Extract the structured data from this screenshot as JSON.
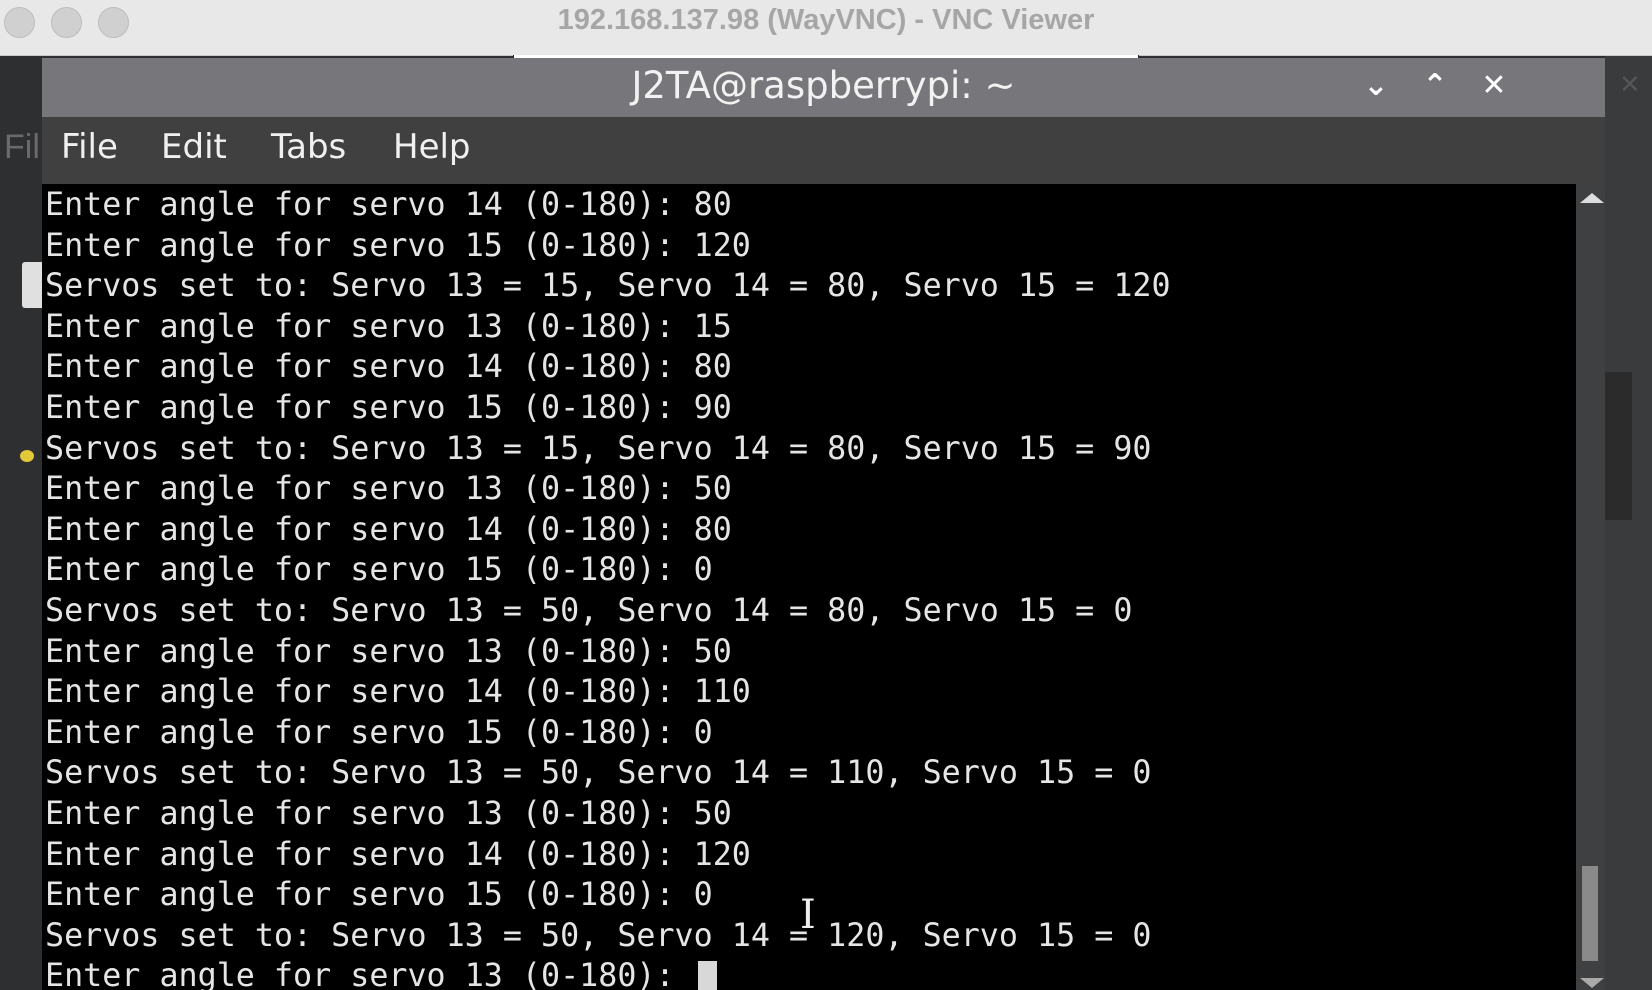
{
  "vnc_window": {
    "title": "192.168.137.98 (WayVNC) - VNC Viewer"
  },
  "background_fragment": "Fil",
  "terminal_window": {
    "title": "J2TA@raspberrypi: ~",
    "controls": {
      "minimize": "⌄",
      "maximize": "⌃",
      "close": "✕"
    },
    "menu": [
      "File",
      "Edit",
      "Tabs",
      "Help"
    ]
  },
  "terminal": {
    "lines": [
      "Enter angle for servo 14 (0-180): 80",
      "Enter angle for servo 15 (0-180): 120",
      "Servos set to: Servo 13 = 15, Servo 14 = 80, Servo 15 = 120",
      "Enter angle for servo 13 (0-180): 15",
      "Enter angle for servo 14 (0-180): 80",
      "Enter angle for servo 15 (0-180): 90",
      "Servos set to: Servo 13 = 15, Servo 14 = 80, Servo 15 = 90",
      "Enter angle for servo 13 (0-180): 50",
      "Enter angle for servo 14 (0-180): 80",
      "Enter angle for servo 15 (0-180): 0",
      "Servos set to: Servo 13 = 50, Servo 14 = 80, Servo 15 = 0",
      "Enter angle for servo 13 (0-180): 50",
      "Enter angle for servo 14 (0-180): 110",
      "Enter angle for servo 15 (0-180): 0",
      "Servos set to: Servo 13 = 50, Servo 14 = 110, Servo 15 = 0",
      "Enter angle for servo 13 (0-180): 50",
      "Enter angle for servo 14 (0-180): 120",
      "Enter angle for servo 15 (0-180): 0",
      "Servos set to: Servo 13 = 50, Servo 14 = 120, Servo 15 = 0"
    ],
    "prompt_line": "Enter angle for servo 13 (0-180): ",
    "scroll_position": 0.95
  }
}
